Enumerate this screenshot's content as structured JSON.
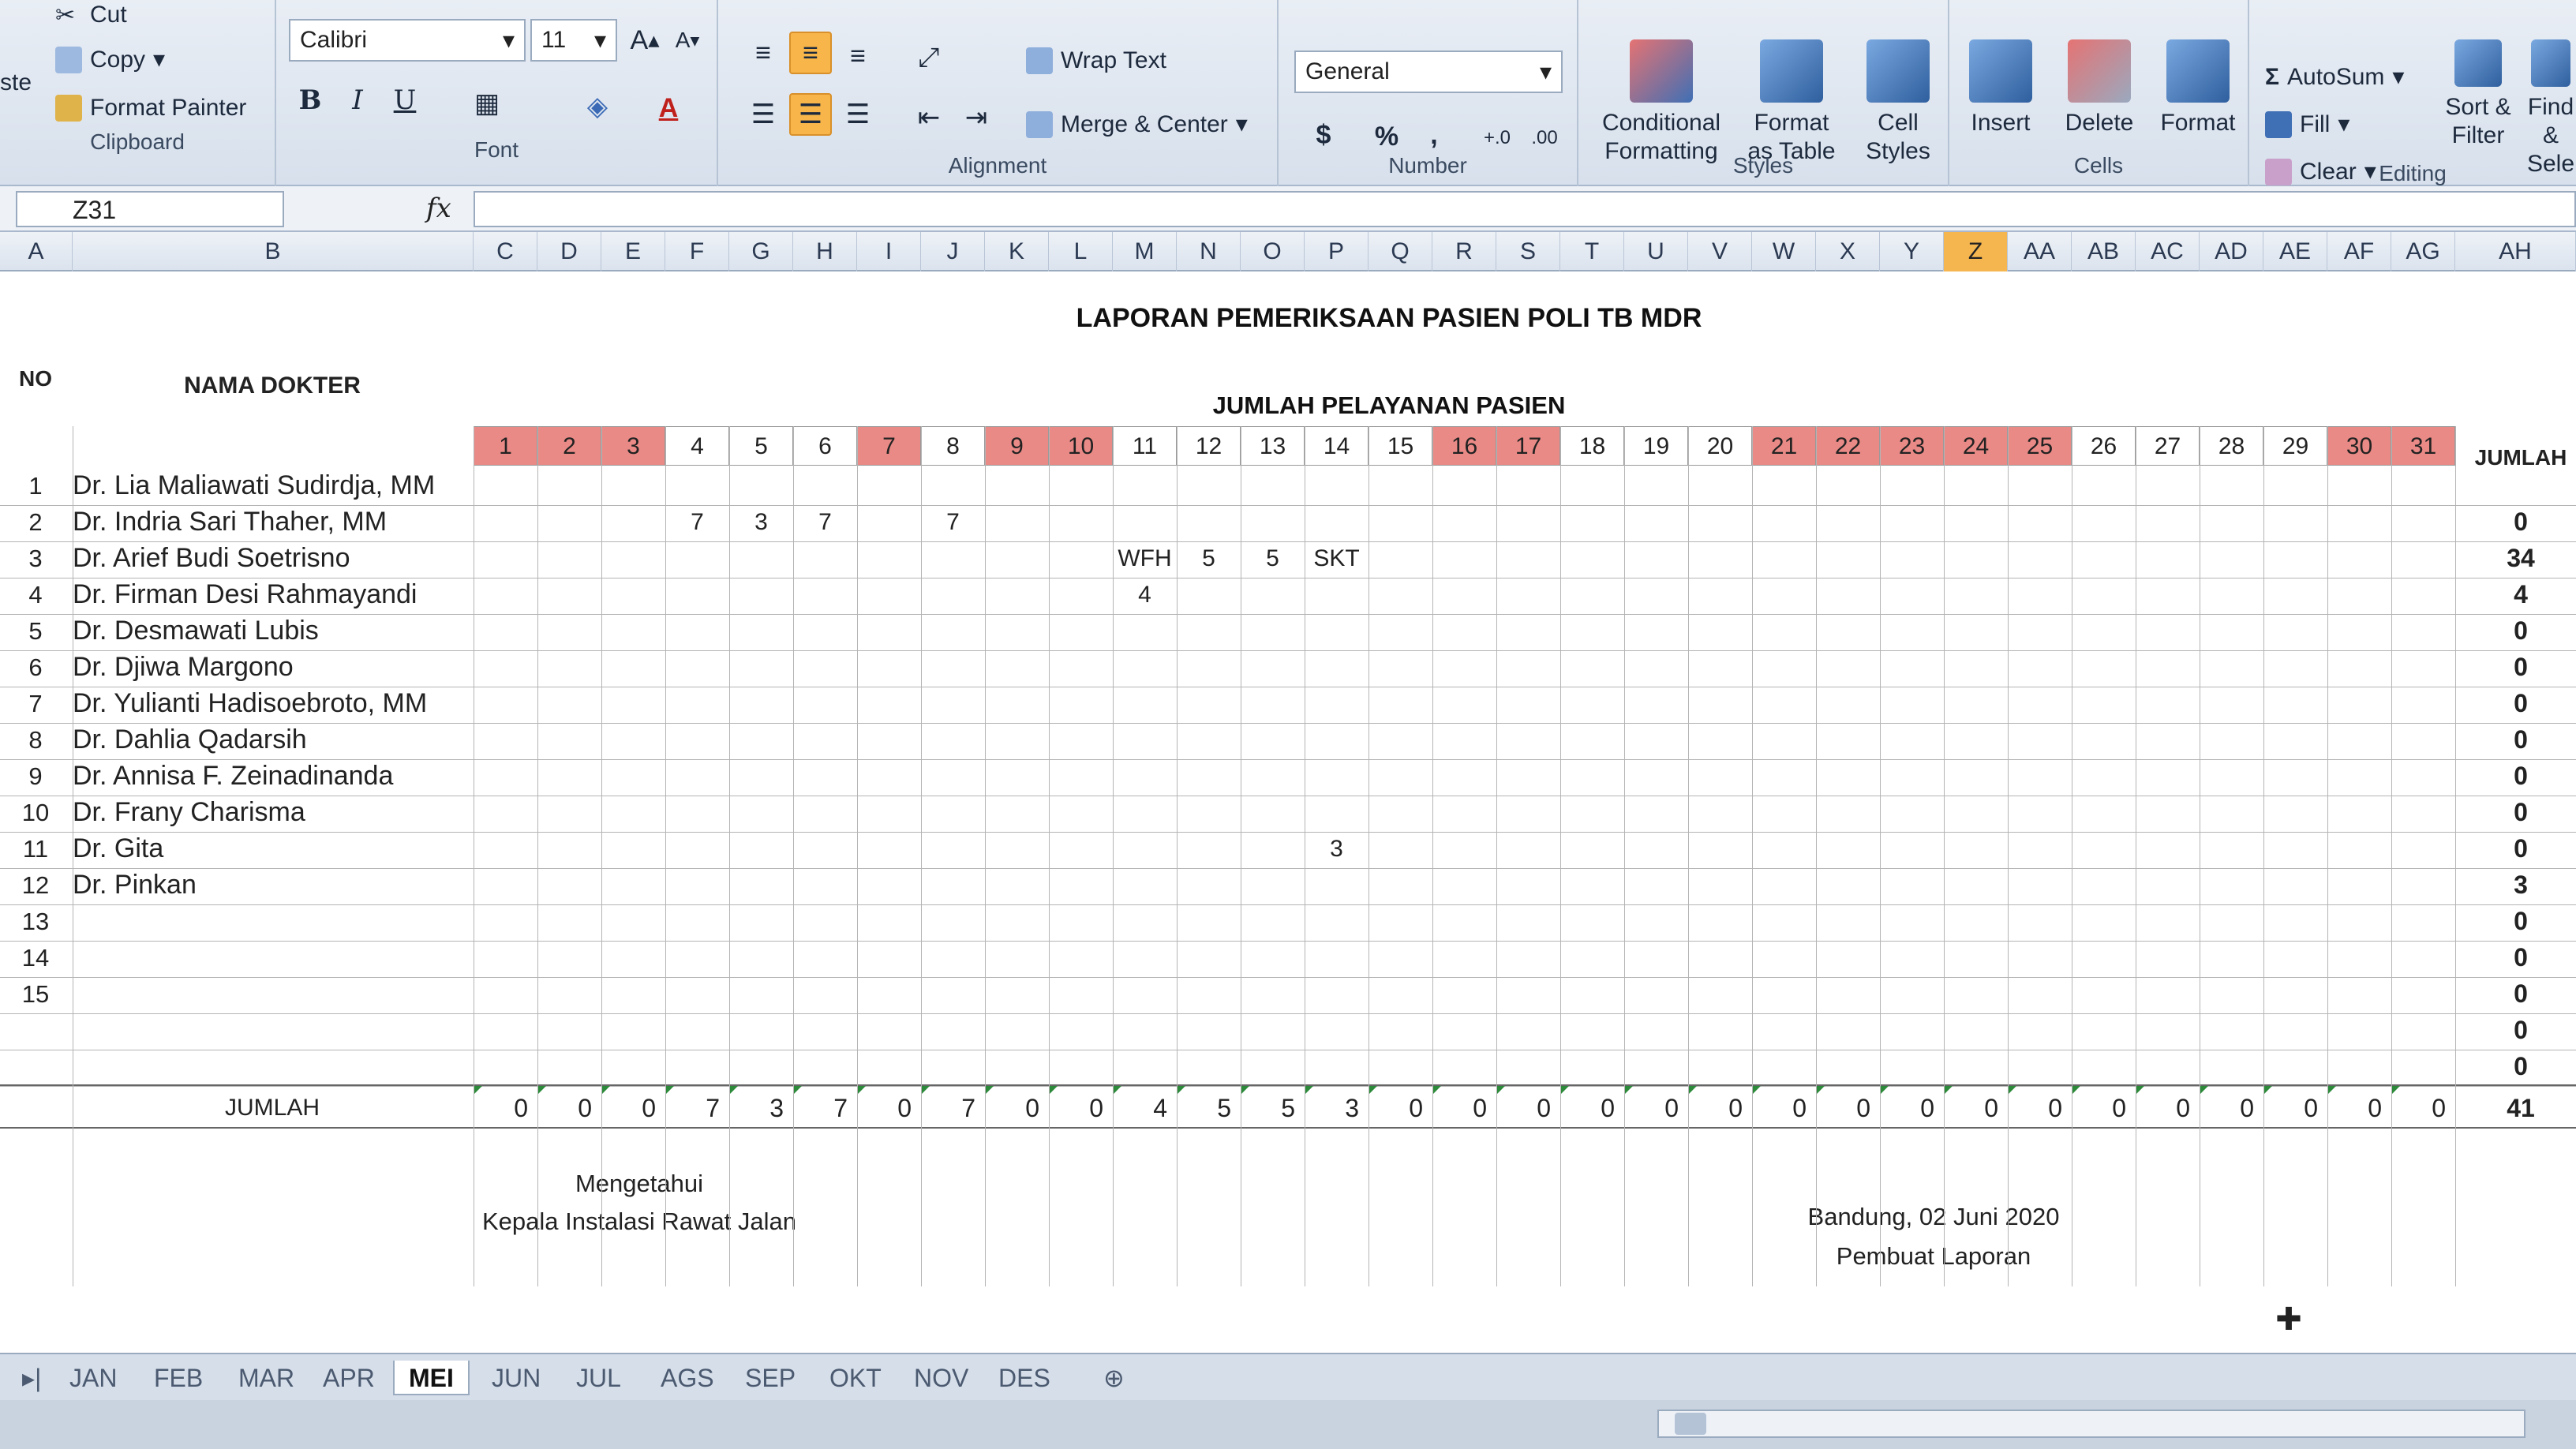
{
  "ribbon": {
    "clipboard": {
      "label": "Clipboard",
      "paste": "ste",
      "cut": "Cut",
      "copy": "Copy",
      "format_painter": "Format Painter"
    },
    "font": {
      "label": "Font",
      "name": "Calibri",
      "size": "11"
    },
    "alignment": {
      "label": "Alignment",
      "wrap_text": "Wrap Text",
      "merge_center": "Merge & Center"
    },
    "number": {
      "label": "Number",
      "format": "General",
      "currency": "$",
      "percent": "%",
      "comma": ","
    },
    "styles": {
      "label": "Styles",
      "conditional": "Conditional Formatting",
      "format_table": "Format as Table",
      "cell_styles": "Cell Styles"
    },
    "cells": {
      "label": "Cells",
      "insert": "Insert",
      "delete": "Delete",
      "format": "Format"
    },
    "editing": {
      "label": "Editing",
      "autosum": "AutoSum",
      "fill": "Fill",
      "clear": "Clear",
      "sort_filter": "Sort & Filter",
      "find_select": "Find & Sele"
    }
  },
  "formula_bar": {
    "name_box": "Z31",
    "fx": "fx",
    "value": ""
  },
  "columns": [
    "A",
    "B",
    "C",
    "D",
    "E",
    "F",
    "G",
    "H",
    "I",
    "J",
    "K",
    "L",
    "M",
    "N",
    "O",
    "P",
    "Q",
    "R",
    "S",
    "T",
    "U",
    "V",
    "W",
    "X",
    "Y",
    "Z",
    "AA",
    "AB",
    "AC",
    "AD",
    "AE",
    "AF",
    "AG",
    "AH"
  ],
  "active_column": "Z",
  "sheet": {
    "title": "LAPORAN PEMERIKSAAN PASIEN POLI TB MDR",
    "subtitle": "JUMLAH PELAYANAN PASIEN",
    "header_no": "NO",
    "header_name": "NAMA DOKTER",
    "header_total": "JUMLAH",
    "days": [
      "1",
      "2",
      "3",
      "4",
      "5",
      "6",
      "7",
      "8",
      "9",
      "10",
      "11",
      "12",
      "13",
      "14",
      "15",
      "16",
      "17",
      "18",
      "19",
      "20",
      "21",
      "22",
      "23",
      "24",
      "25",
      "26",
      "27",
      "28",
      "29",
      "30",
      "31"
    ],
    "weekend_days": [
      1,
      2,
      3,
      7,
      9,
      10,
      16,
      17,
      21,
      22,
      23,
      24,
      25,
      30,
      31
    ],
    "rows": [
      {
        "no": "1",
        "name": "Dr. Lia Maliawati Sudirdja, MM",
        "cells": {},
        "total": ""
      },
      {
        "no": "2",
        "name": "Dr. Indria Sari Thaher, MM",
        "cells": {
          "4": "7",
          "5": "3",
          "6": "7",
          "8": "7"
        },
        "total": "0"
      },
      {
        "no": "3",
        "name": "Dr. Arief Budi Soetrisno",
        "cells": {
          "11": "WFH",
          "12": "5",
          "13": "5",
          "14": "SKT"
        },
        "total": "34"
      },
      {
        "no": "4",
        "name": "Dr. Firman Desi Rahmayandi",
        "cells": {
          "11": "4"
        },
        "total": "4"
      },
      {
        "no": "5",
        "name": "Dr. Desmawati Lubis",
        "cells": {},
        "total": "0"
      },
      {
        "no": "6",
        "name": "Dr. Djiwa Margono",
        "cells": {},
        "total": "0"
      },
      {
        "no": "7",
        "name": "Dr. Yulianti Hadisoebroto, MM",
        "cells": {},
        "total": "0"
      },
      {
        "no": "8",
        "name": "Dr. Dahlia Qadarsih",
        "cells": {},
        "total": "0"
      },
      {
        "no": "9",
        "name": "Dr. Annisa F. Zeinadinanda",
        "cells": {},
        "total": "0"
      },
      {
        "no": "10",
        "name": "Dr. Frany Charisma",
        "cells": {},
        "total": "0"
      },
      {
        "no": "11",
        "name": "Dr. Gita",
        "cells": {
          "14": "3"
        },
        "total": "0"
      },
      {
        "no": "12",
        "name": "Dr. Pinkan",
        "cells": {},
        "total": "3"
      },
      {
        "no": "13",
        "name": "",
        "cells": {},
        "total": "0"
      },
      {
        "no": "14",
        "name": "",
        "cells": {},
        "total": "0"
      },
      {
        "no": "15",
        "name": "",
        "cells": {},
        "total": "0"
      },
      {
        "no": "",
        "name": "",
        "cells": {},
        "total": "0"
      },
      {
        "no": "",
        "name": "",
        "cells": {},
        "total": "0"
      }
    ],
    "jumlah_label": "JUMLAH",
    "jumlah_values": [
      "0",
      "0",
      "0",
      "7",
      "3",
      "7",
      "0",
      "7",
      "0",
      "0",
      "4",
      "5",
      "5",
      "3",
      "0",
      "0",
      "0",
      "0",
      "0",
      "0",
      "0",
      "0",
      "0",
      "0",
      "0",
      "0",
      "0",
      "0",
      "0",
      "0",
      "0"
    ],
    "jumlah_total": "41",
    "sign_left_1": "Mengetahui",
    "sign_left_2": "Kepala Instalasi Rawat Jalan",
    "sign_right_1": "Bandung, 02 Juni 2020",
    "sign_right_2": "Pembuat Laporan"
  },
  "tabs": [
    "JAN",
    "FEB",
    "MAR",
    "APR",
    "MEI",
    "JUN",
    "JUL",
    "AGS",
    "SEP",
    "OKT",
    "NOV",
    "DES"
  ],
  "active_tab": "MEI",
  "colors": {
    "weekend": "#e98a86",
    "active_col": "#f5b650",
    "ribbon": "#dfe6ee"
  }
}
